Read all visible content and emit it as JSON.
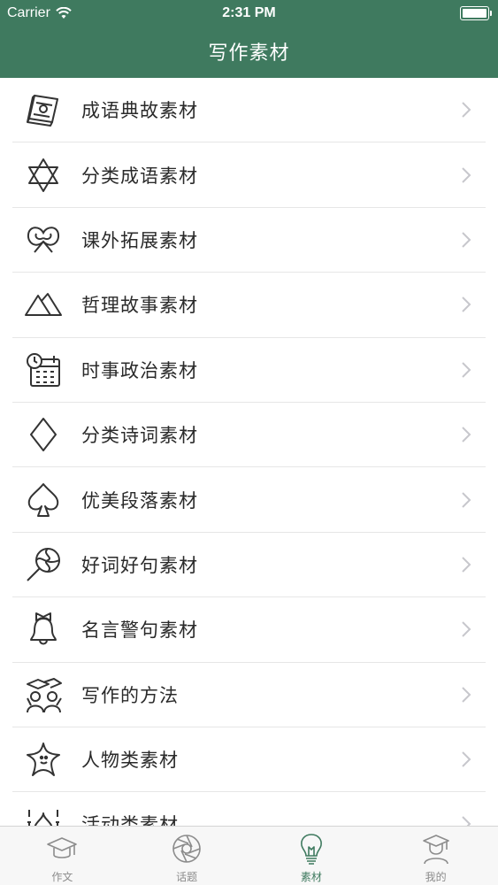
{
  "status_bar": {
    "carrier": "Carrier",
    "time": "2:31 PM"
  },
  "nav": {
    "title": "写作素材"
  },
  "list": {
    "items": [
      {
        "label": "成语典故素材",
        "icon": "book-icon"
      },
      {
        "label": "分类成语素材",
        "icon": "star-of-david-icon"
      },
      {
        "label": "课外拓展素材",
        "icon": "pretzel-icon"
      },
      {
        "label": "哲理故事素材",
        "icon": "mountains-icon"
      },
      {
        "label": "时事政治素材",
        "icon": "calendar-clock-icon"
      },
      {
        "label": "分类诗词素材",
        "icon": "diamond-icon"
      },
      {
        "label": "优美段落素材",
        "icon": "spade-icon"
      },
      {
        "label": "好词好句素材",
        "icon": "lollipop-icon"
      },
      {
        "label": "名言警句素材",
        "icon": "bell-icon"
      },
      {
        "label": "写作的方法",
        "icon": "graduates-icon"
      },
      {
        "label": "人物类素材",
        "icon": "starfish-icon"
      },
      {
        "label": "活动类素材",
        "icon": "mosque-icon"
      }
    ]
  },
  "tabbar": {
    "tabs": [
      {
        "label": "作文",
        "icon": "graduation-cap-icon",
        "active": false
      },
      {
        "label": "话题",
        "icon": "aperture-icon",
        "active": false
      },
      {
        "label": "素材",
        "icon": "lightbulb-icon",
        "active": true
      },
      {
        "label": "我的",
        "icon": "user-grad-icon",
        "active": false
      }
    ]
  },
  "colors": {
    "accent": "#3f7a5f",
    "separator": "#e6e6e6",
    "chevron": "#c7c7cc"
  }
}
